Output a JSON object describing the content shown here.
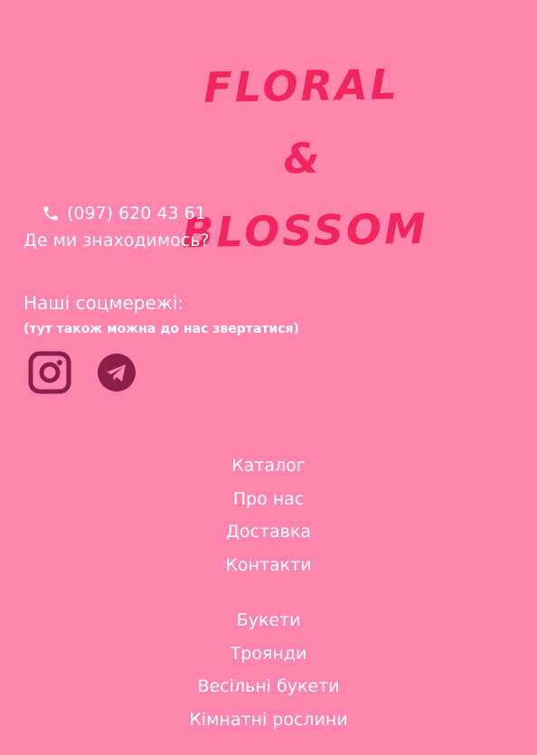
{
  "logo": {
    "line1": "FLORAL &",
    "line2": "BLOSSOM"
  },
  "contact": {
    "phone_icon": "phone-icon",
    "phone": "(097) 620 43 61",
    "location_link": "Де ми знаходимось?"
  },
  "social": {
    "title": "Наші соцмережі:",
    "note": "(тут також можна до нас звертатися)",
    "icons": [
      "instagram-icon",
      "telegram-icon"
    ]
  },
  "nav_main": {
    "items": [
      "Каталог",
      "Про нас",
      "Доставка",
      "Контакти"
    ]
  },
  "nav_categories": {
    "items": [
      "Букети",
      "Троянди",
      "Весільні букети",
      "Кімнатні рослини"
    ]
  },
  "colors": {
    "background": "#ff85ad",
    "logo": "#f2265f",
    "icon_dark": "#8a1f4b",
    "text": "#ffffff"
  }
}
